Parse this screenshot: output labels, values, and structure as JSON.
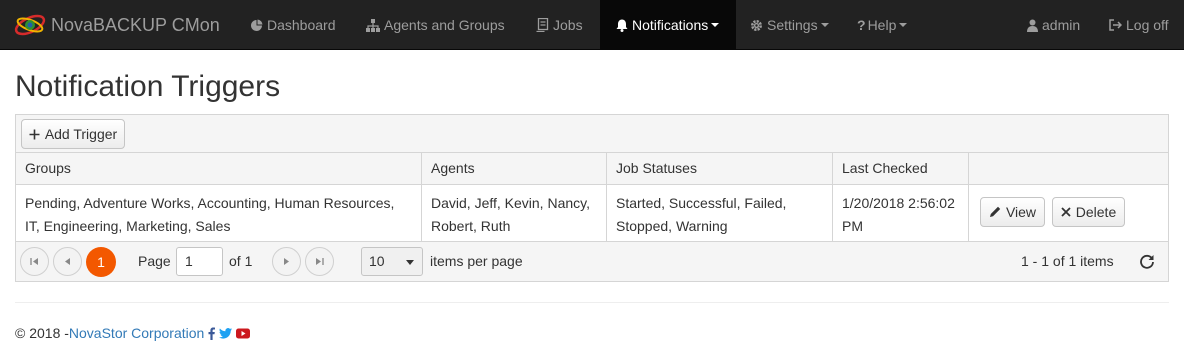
{
  "navbar": {
    "brand": "NovaBACKUP CMon",
    "items": [
      {
        "label": "Dashboard",
        "icon": "dashboard-icon"
      },
      {
        "label": "Agents and Groups",
        "icon": "sitemap-icon"
      },
      {
        "label": "Jobs",
        "icon": "jobs-icon"
      },
      {
        "label": "Notifications",
        "icon": "bell-icon",
        "active": true
      },
      {
        "label": "Settings",
        "icon": "gear-icon"
      },
      {
        "label": "Help",
        "icon": "question-icon"
      }
    ],
    "user": "admin",
    "logoff": "Log off"
  },
  "page": {
    "title": "Notification Triggers"
  },
  "toolbar": {
    "add_trigger": "Add Trigger"
  },
  "table": {
    "columns": [
      "Groups",
      "Agents",
      "Job Statuses",
      "Last Checked",
      ""
    ],
    "rows": [
      {
        "groups_line1": "Pending, Adventure Works, Accounting, Human Resources,",
        "groups_line2": "IT, Engineering, Marketing, Sales",
        "agents_line1": "David, Jeff, Kevin, Nancy,",
        "agents_line2": "Robert, Ruth",
        "statuses_line1": "Started, Successful, Failed,",
        "statuses_line2": "Stopped, Warning",
        "checked_line1": "1/20/2018 2:56:02",
        "checked_line2": "PM",
        "view": "View",
        "delete": "Delete"
      }
    ]
  },
  "pager": {
    "current_page": "1",
    "page_label": "Page",
    "page_value": "1",
    "of_label": "of 1",
    "page_size": "10",
    "items_per_page": "items per page",
    "summary": "1 - 1 of 1 items"
  },
  "footer": {
    "copyright": "© 2018 - ",
    "company": "NovaStor Corporation"
  },
  "colors": {
    "navbar_bg": "#222222",
    "active_nav_bg": "#080808",
    "accent_orange": "#f35800",
    "link_blue": "#337ab7",
    "facebook": "#3b5998",
    "twitter": "#1da1f2",
    "youtube": "#cc181e"
  }
}
